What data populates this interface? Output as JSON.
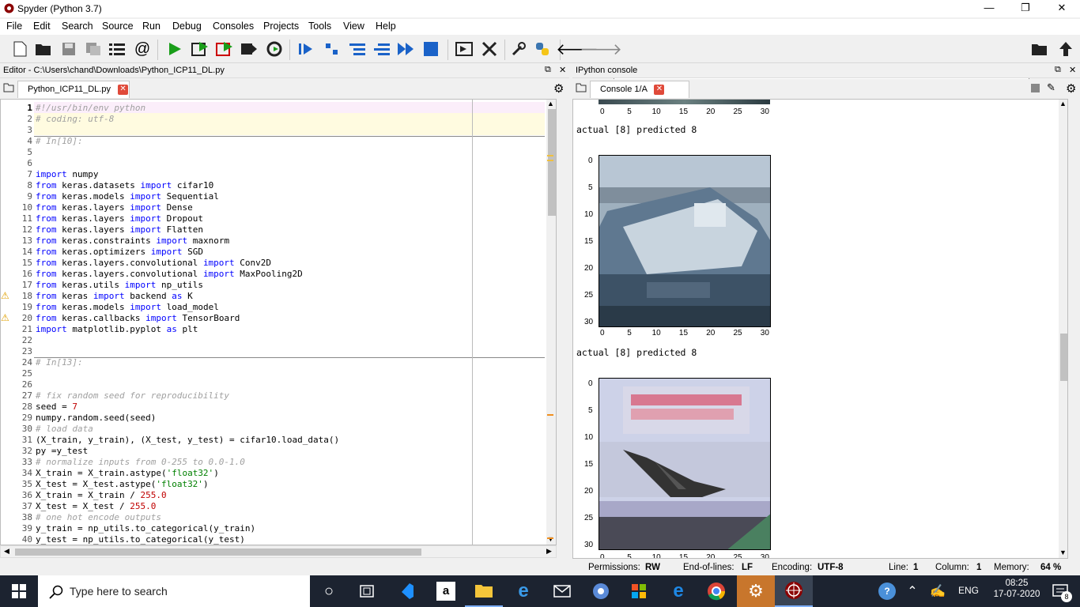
{
  "window": {
    "title": "Spyder (Python 3.7)",
    "minimize": "—",
    "restore": "❐",
    "close": "✕"
  },
  "menu": [
    "File",
    "Edit",
    "Search",
    "Source",
    "Run",
    "Debug",
    "Consoles",
    "Projects",
    "Tools",
    "View",
    "Help"
  ],
  "toolbar": {
    "path": "C:\\Users\\chand\\Downloads"
  },
  "editor": {
    "header": "Editor - C:\\Users\\chand\\Downloads\\Python_ICP11_DL.py",
    "tab": "Python_ICP11_DL.py",
    "lines": [
      "#!/usr/bin/env python",
      "# coding: utf-8",
      "",
      "# In[10]:",
      "",
      "",
      "import numpy",
      "from keras.datasets import cifar10",
      "from keras.models import Sequential",
      "from keras.layers import Dense",
      "from keras.layers import Dropout",
      "from keras.layers import Flatten",
      "from keras.constraints import maxnorm",
      "from keras.optimizers import SGD",
      "from keras.layers.convolutional import Conv2D",
      "from keras.layers.convolutional import MaxPooling2D",
      "from keras.utils import np_utils",
      "from keras import backend as K",
      "from keras.models import load_model",
      "from keras.callbacks import TensorBoard",
      "import matplotlib.pyplot as plt",
      "",
      "",
      "# In[13]:",
      "",
      "",
      "# fix random seed for reproducibility",
      "seed = 7",
      "numpy.random.seed(seed)",
      "# load data",
      "(X_train, y_train), (X_test, y_test) = cifar10.load_data()",
      "py =y_test",
      "# normalize inputs from 0-255 to 0.0-1.0",
      "X_train = X_train.astype('float32')",
      "X_test = X_test.astype('float32')",
      "X_train = X_train / 255.0",
      "X_test = X_test / 255.0",
      "# one hot encode outputs",
      "y_train = np_utils.to_categorical(y_train)",
      "y_test = np_utils.to_categorical(y_test)"
    ]
  },
  "console": {
    "header": "IPython console",
    "tab": "Console 1/A",
    "outputs": [
      "actual [8] predicted 8",
      "actual [8] predicted 8"
    ],
    "xticks": [
      "0",
      "5",
      "10",
      "15",
      "20",
      "25",
      "30"
    ],
    "yticks": [
      "0",
      "5",
      "10",
      "15",
      "20",
      "25",
      "30"
    ]
  },
  "status": {
    "permissions_label": "Permissions:",
    "permissions": "RW",
    "eol_label": "End-of-lines:",
    "eol": "LF",
    "encoding_label": "Encoding:",
    "encoding": "UTF-8",
    "line_label": "Line:",
    "line": "1",
    "column_label": "Column:",
    "column": "1",
    "memory_label": "Memory:",
    "memory": "64 %"
  },
  "taskbar": {
    "search_placeholder": "Type here to search",
    "lang": "ENG",
    "time": "08:25",
    "date": "17-07-2020",
    "notifications": "8"
  }
}
